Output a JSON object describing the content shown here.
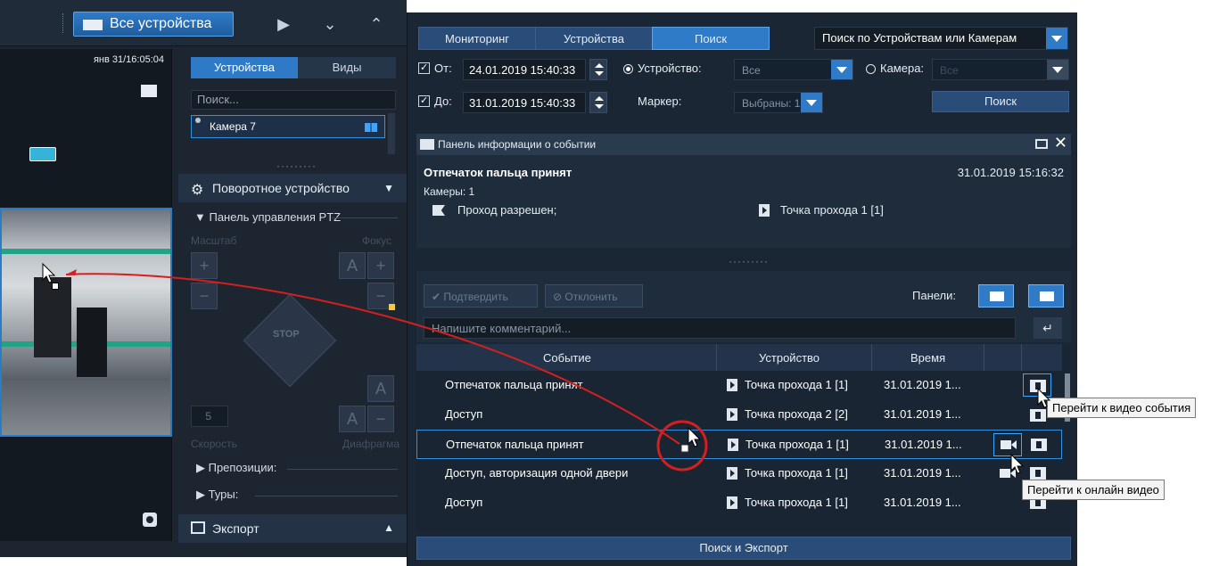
{
  "left": {
    "topbar": {
      "all_devices": "Все устройства"
    },
    "video": {
      "timestamp": "янв 31/16:05:04"
    },
    "side": {
      "tab_devices": "Устройства",
      "tab_views": "Виды",
      "search_placeholder": "Поиск...",
      "camera_item": "Камера 7",
      "divider": "·········",
      "ptz_header": "Поворотное устройство",
      "ptz_panel": "Панель управления PTZ",
      "scale_label": "Масштаб",
      "focus_label": "Фокус",
      "speed_label": "Скорость",
      "aperture_label": "Диафрагма",
      "speed_value": "5",
      "stop_label": "STOP",
      "presets_label": "Препозиции:",
      "tours_label": "Туры:",
      "export_label": "Экспорт"
    }
  },
  "right": {
    "tabs": {
      "monitoring": "Мониторинг",
      "devices": "Устройства",
      "search": "Поиск"
    },
    "search_scope": "Поиск по Устройствам или Камерам",
    "filters": {
      "from_label": "От:",
      "from_value": "24.01.2019 15:40:33",
      "to_label": "До:",
      "to_value": "31.01.2019 15:40:33",
      "device_label": "Устройство:",
      "device_value": "Все",
      "camera_label": "Камера:",
      "camera_value": "Все",
      "marker_label": "Маркер:",
      "marker_value": "Выбраны: 1",
      "search_button": "Поиск"
    },
    "info_panel": {
      "title": "Панель информации о событии",
      "event_title": "Отпечаток пальца принят",
      "event_time": "31.01.2019 15:16:32",
      "cameras": "Камеры: 1",
      "pass_granted": "Проход разрешен;",
      "access_point": "Точка прохода 1 [1]"
    },
    "divider": "·········",
    "confirm_button": "Подтвердить",
    "reject_button": "Отклонить",
    "panels_label": "Панели:",
    "comment_placeholder": "Напишите комментарий...",
    "table": {
      "columns": [
        "Событие",
        "Устройство",
        "Время"
      ],
      "rows": [
        {
          "event": "Отпечаток пальца принят",
          "device": "Точка прохода 1 [1]",
          "time": "31.01.2019 1..."
        },
        {
          "event": "Доступ",
          "device": "Точка прохода 2 [2]",
          "time": "31.01.2019 1..."
        },
        {
          "event": "Отпечаток пальца принят",
          "device": "Точка прохода 1 [1]",
          "time": "31.01.2019 1..."
        },
        {
          "event": "Доступ, авторизация одной двери",
          "device": "Точка прохода 1 [1]",
          "time": "31.01.2019 1..."
        },
        {
          "event": "Доступ",
          "device": "Точка прохода 1 [1]",
          "time": "31.01.2019 1..."
        }
      ]
    },
    "bottom_button": "Поиск и Экспорт",
    "tooltip_event_video": "Перейти к видео события",
    "tooltip_online_video": "Перейти к онлайн видео"
  },
  "colors": {
    "accent": "#2f7bc8",
    "panel": "#1b2634",
    "annotation_arrow": "#d41f1f"
  }
}
